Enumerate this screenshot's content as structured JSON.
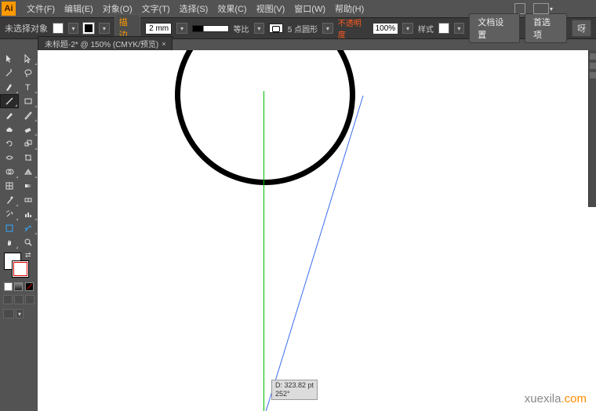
{
  "app": {
    "logo": "Ai"
  },
  "menu": {
    "file": "文件(F)",
    "edit": "编辑(E)",
    "object": "对象(O)",
    "type": "文字(T)",
    "select": "选择(S)",
    "effect": "效果(C)",
    "view": "视图(V)",
    "window": "窗口(W)",
    "help": "帮助(H)"
  },
  "options": {
    "status": "未选择对象",
    "stroke_label": "描边",
    "stroke_weight": "2 mm",
    "variable_width": "等比",
    "brush_label": "5 点圆形",
    "opacity_label": "不透明度",
    "opacity_value": "100%",
    "style_label": "样式",
    "doc_setup": "文档设置",
    "prefs": "首选项",
    "more": "呀"
  },
  "document": {
    "tab_label": "未标题-2* @ 150% (CMYK/预览)"
  },
  "canvas": {
    "measurement_d": "D: 323.82 pt",
    "measurement_angle": "252°"
  },
  "tools": {
    "icons": [
      "selection",
      "direct-selection",
      "magic-wand",
      "lasso",
      "pen",
      "type",
      "line-segment",
      "rectangle",
      "paintbrush",
      "pencil",
      "blob-brush",
      "eraser",
      "rotate",
      "scale",
      "width",
      "free-transform",
      "shape-builder",
      "perspective-grid",
      "mesh",
      "gradient",
      "eyedropper",
      "blend",
      "symbol-sprayer",
      "column-graph",
      "artboard",
      "slice",
      "hand",
      "zoom"
    ]
  },
  "watermark": {
    "text_gray": "xuexila",
    "text_orange": ".com"
  }
}
